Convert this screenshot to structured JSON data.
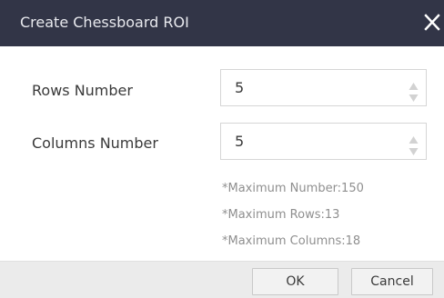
{
  "dialog": {
    "title": "Create Chessboard ROI",
    "close_icon": "close-icon"
  },
  "form": {
    "rows": {
      "label": "Rows Number",
      "value": "5",
      "up_icon": "triangle-up-icon",
      "down_icon": "triangle-down-icon"
    },
    "columns": {
      "label": "Columns Number",
      "value": "5",
      "up_icon": "triangle-up-icon",
      "down_icon": "triangle-down-icon"
    }
  },
  "hints": [
    "*Maximum Number:150",
    "*Maximum Rows:13",
    "*Maximum Columns:18"
  ],
  "footer": {
    "ok_label": "OK",
    "cancel_label": "Cancel"
  },
  "colors": {
    "titlebar": "#323547",
    "title_text": "#e8e9ee",
    "spin_arrow": "#d2d2d2",
    "hint_text": "#8f8f8f",
    "footer_bg": "#ebebeb"
  }
}
